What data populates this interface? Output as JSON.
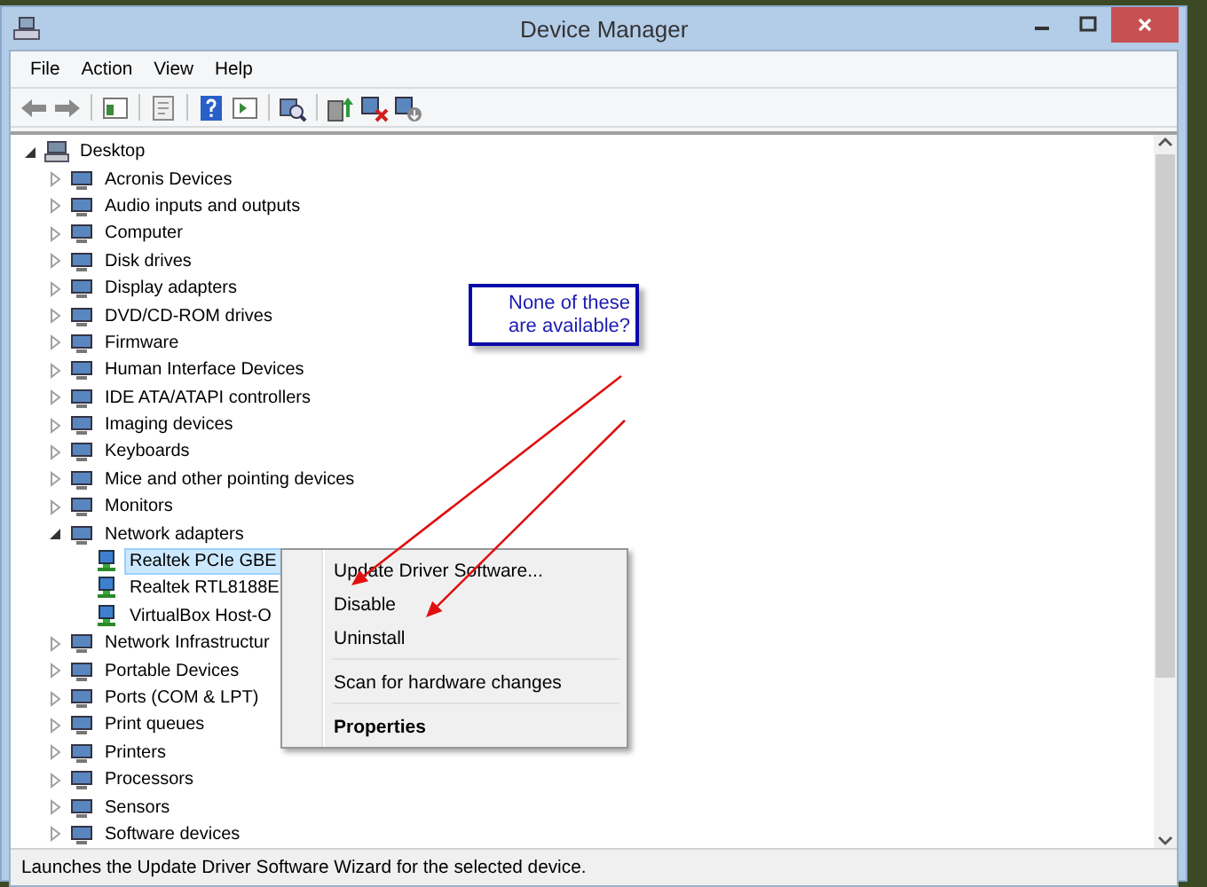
{
  "window": {
    "title": "Device Manager"
  },
  "menu_bar": [
    "File",
    "Action",
    "View",
    "Help"
  ],
  "tree": [
    {
      "label": "Desktop",
      "expanded": true,
      "selected": false,
      "children": [
        {
          "label": "Acronis Devices",
          "expanded": false,
          "selected": false
        },
        {
          "label": "Audio inputs and outputs",
          "expanded": false,
          "selected": false
        },
        {
          "label": "Computer",
          "expanded": false,
          "selected": false
        },
        {
          "label": "Disk drives",
          "expanded": false,
          "selected": false
        },
        {
          "label": "Display adapters",
          "expanded": false,
          "selected": false
        },
        {
          "label": "DVD/CD-ROM drives",
          "expanded": false,
          "selected": false
        },
        {
          "label": "Firmware",
          "expanded": false,
          "selected": false
        },
        {
          "label": "Human Interface Devices",
          "expanded": false,
          "selected": false
        },
        {
          "label": "IDE ATA/ATAPI controllers",
          "expanded": false,
          "selected": false
        },
        {
          "label": "Imaging devices",
          "expanded": false,
          "selected": false
        },
        {
          "label": "Keyboards",
          "expanded": false,
          "selected": false
        },
        {
          "label": "Mice and other pointing devices",
          "expanded": false,
          "selected": false
        },
        {
          "label": "Monitors",
          "expanded": false,
          "selected": false
        },
        {
          "label": "Network adapters",
          "expanded": true,
          "selected": false,
          "children": [
            {
              "label": "Realtek PCIe GBE",
              "selected": true
            },
            {
              "label": "Realtek RTL8188E",
              "selected": false
            },
            {
              "label": "VirtualBox Host-O",
              "selected": false
            }
          ]
        },
        {
          "label": "Network Infrastructur",
          "expanded": false,
          "selected": false
        },
        {
          "label": "Portable Devices",
          "expanded": false,
          "selected": false
        },
        {
          "label": "Ports (COM & LPT)",
          "expanded": false,
          "selected": false
        },
        {
          "label": "Print queues",
          "expanded": false,
          "selected": false
        },
        {
          "label": "Printers",
          "expanded": false,
          "selected": false
        },
        {
          "label": "Processors",
          "expanded": false,
          "selected": false
        },
        {
          "label": "Sensors",
          "expanded": false,
          "selected": false
        },
        {
          "label": "Software devices",
          "expanded": false,
          "selected": false
        }
      ]
    }
  ],
  "context_menu": [
    [
      {
        "label": "Update Driver Software...",
        "default": false
      },
      {
        "label": "Disable",
        "default": false
      },
      {
        "label": "Uninstall",
        "default": false
      }
    ],
    [
      {
        "label": "Scan for hardware changes",
        "default": false
      }
    ],
    [
      {
        "label": "Properties",
        "default": true
      }
    ]
  ],
  "callout": {
    "lines": [
      "None of these",
      "are available?"
    ]
  },
  "status_bar": "Launches the Update Driver Software Wizard for the selected device."
}
